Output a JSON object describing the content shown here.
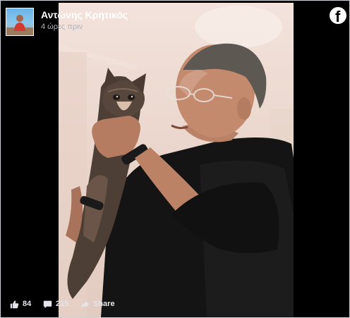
{
  "post": {
    "author_name": "Αντώνης Κρητικός",
    "timestamp": "4 ώρες πριν"
  },
  "brand": {
    "logo_letter": "f",
    "icon": "facebook-logo-icon"
  },
  "reactions": {
    "like_count": "84",
    "comment_count": "215",
    "share_label": "Share"
  },
  "icons": {
    "like": "thumbs-up-icon",
    "comment": "speech-bubble-icon",
    "share": "share-arrow-icon"
  },
  "colors": {
    "frame": "#000000",
    "text_primary": "#ffffff",
    "text_secondary": "#b0b3b8"
  }
}
